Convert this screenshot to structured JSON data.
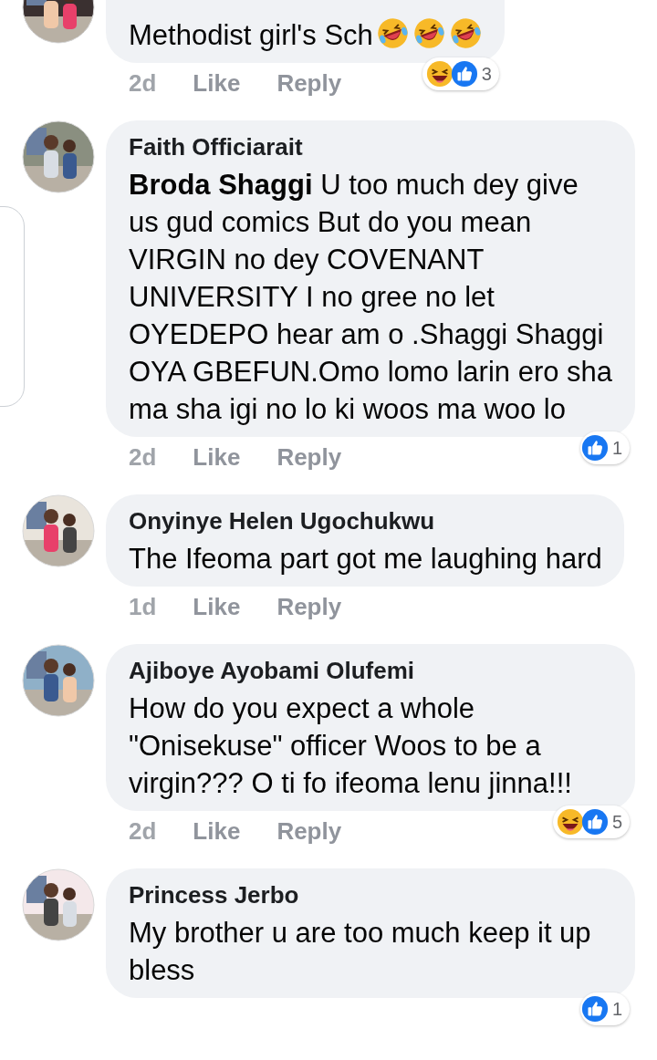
{
  "comments": [
    {
      "text": "Methodist girl's Sch",
      "emojis": [
        {
          "kind": "rofl"
        },
        {
          "kind": "rofl"
        },
        {
          "kind": "rofl"
        }
      ],
      "time": "2d",
      "like": "Like",
      "reply": "Reply",
      "reactions": {
        "icons": [
          {
            "kind": "haha"
          },
          {
            "kind": "like"
          }
        ],
        "count": "3"
      }
    },
    {
      "name": "Faith Officiarait",
      "text": "**Broda Shaggi** U too much dey give us gud comics But do you mean VIRGIN no dey COVENANT UNIVERSITY I no gree no let OYEDEPO hear am o .Shaggi Shaggi OYA GBEFUN.Omo lomo larin ero sha ma sha igi no lo ki woos ma woo lo",
      "time": "2d",
      "like": "Like",
      "reply": "Reply",
      "reactions": {
        "icons": [
          {
            "kind": "like"
          }
        ],
        "count": "1"
      }
    },
    {
      "name": "Onyinye Helen Ugochukwu",
      "text": "The Ifeoma part got me laughing hard",
      "time": "1d",
      "like": "Like",
      "reply": "Reply"
    },
    {
      "name": "Ajiboye Ayobami Olufemi",
      "text": "How do you expect a whole \"Onisekuse\" officer Woos to be a virgin??? O ti fo ifeoma lenu jinna!!!",
      "time": "2d",
      "like": "Like",
      "reply": "Reply",
      "reactions": {
        "icons": [
          {
            "kind": "haha"
          },
          {
            "kind": "like"
          }
        ],
        "count": "5"
      }
    },
    {
      "name": "Princess Jerbo",
      "text": "My brother u are too much keep it up bless",
      "reactions": {
        "icons": [
          {
            "kind": "like"
          }
        ],
        "count": "1"
      }
    }
  ]
}
